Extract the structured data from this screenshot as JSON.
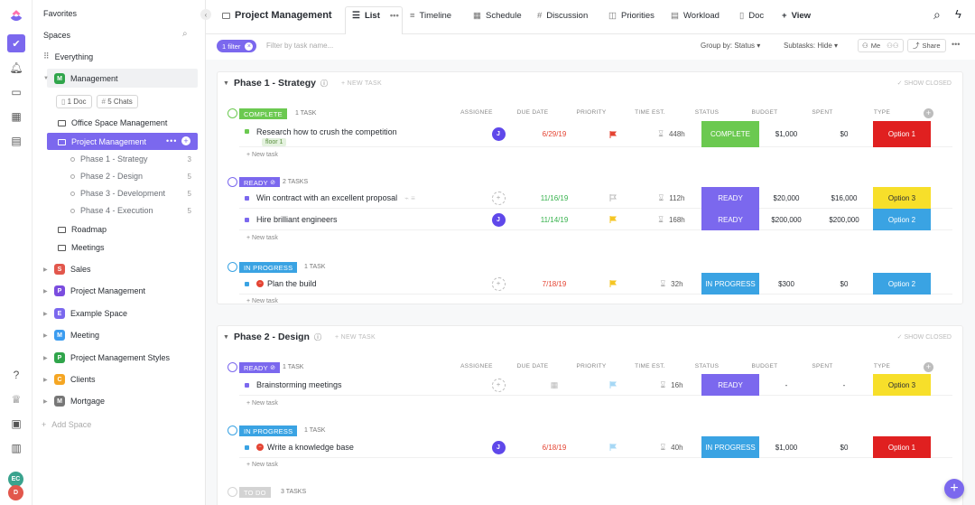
{
  "app": {
    "accent": "#7b68ee"
  },
  "sidebar": {
    "favorites": "Favorites",
    "spaces": "Spaces",
    "everything": "Everything",
    "management": {
      "label": "Management",
      "letter": "M",
      "color": "#30a54b"
    },
    "doc_pill": "1 Doc",
    "chat_pill": "5 Chats",
    "folders": {
      "office": "Office Space Management",
      "pm": "Project Management",
      "roadmap": "Roadmap",
      "meetings": "Meetings"
    },
    "lists": [
      {
        "label": "Phase 1 - Strategy",
        "count": "3"
      },
      {
        "label": "Phase 2 - Design",
        "count": "5"
      },
      {
        "label": "Phase 3 - Development",
        "count": "5"
      },
      {
        "label": "Phase 4 - Execution",
        "count": "5"
      }
    ],
    "spaces_list": [
      {
        "letter": "S",
        "label": "Sales",
        "color": "#e2574c"
      },
      {
        "letter": "P",
        "label": "Project Management",
        "color": "#7b4ddf"
      },
      {
        "letter": "E",
        "label": "Example Space",
        "color": "#7b68ee"
      },
      {
        "letter": "M",
        "label": "Meeting",
        "color": "#3b9cf0"
      },
      {
        "letter": "P",
        "label": "Project Management Styles",
        "color": "#30a54b"
      },
      {
        "letter": "C",
        "label": "Clients",
        "color": "#f5a623"
      },
      {
        "letter": "M",
        "label": "Mortgage",
        "color": "#777777"
      }
    ],
    "add_space": "Add Space"
  },
  "rail": {
    "avatar1": "EC",
    "avatar2": "D"
  },
  "topbar": {
    "title": "Project Management",
    "tabs": [
      "List",
      "Timeline",
      "Schedule",
      "Discussion",
      "Priorities",
      "Workload",
      "Doc"
    ],
    "add_view": "View"
  },
  "filterbar": {
    "filter_chip": "1 filter",
    "search_placeholder": "Filter by task name...",
    "group_by": "Group by: Status",
    "subtasks": "Subtasks: Hide",
    "me": "Me",
    "share": "Share"
  },
  "columns": [
    "ASSIGNEE",
    "DUE DATE",
    "PRIORITY",
    "TIME EST.",
    "STATUS",
    "BUDGET",
    "SPENT",
    "TYPE"
  ],
  "new_task": "+ New task",
  "phases": [
    {
      "title": "Phase 1 - Strategy",
      "new_task_btn": "+ NEW TASK",
      "show_closed": "SHOW CLOSED",
      "groups": [
        {
          "status": "COMPLETE",
          "color": "#6bc950",
          "count": "1 TASK",
          "tasks": [
            {
              "name": "Research how to crush the competition",
              "tag": "floor 1",
              "assignee": "J",
              "due": "6/29/19",
              "due_color": "red",
              "priority_color": "#e44332",
              "time": "448h",
              "status": "COMPLETE",
              "status_color": "#6bc950",
              "budget": "$1,000",
              "spent": "$0",
              "type": "Option 1",
              "type_color": "#e02020",
              "type_text": "#ffffff"
            }
          ]
        },
        {
          "status": "READY",
          "color": "#7b68ee",
          "count": "2 TASKS",
          "tasks": [
            {
              "name": "Win contract with an excellent proposal",
              "assignee": "",
              "due": "11/16/19",
              "due_color": "green",
              "priority_color": "#d0d0d0",
              "time": "112h",
              "status": "READY",
              "status_color": "#7b68ee",
              "budget": "$20,000",
              "spent": "$16,000",
              "type": "Option 3",
              "type_color": "#f7df2a",
              "type_text": "#2a2e34"
            },
            {
              "name": "Hire brilliant engineers",
              "assignee": "J",
              "due": "11/14/19",
              "due_color": "green",
              "priority_color": "#f5c623",
              "time": "168h",
              "status": "READY",
              "status_color": "#7b68ee",
              "budget": "$200,000",
              "spent": "$200,000",
              "type": "Option 2",
              "type_color": "#3aa3e3",
              "type_text": "#ffffff"
            }
          ]
        },
        {
          "status": "IN PROGRESS",
          "color": "#3aa3e3",
          "count": "1 TASK",
          "tasks": [
            {
              "name": "Plan the build",
              "assignee": "",
              "due": "7/18/19",
              "due_color": "red",
              "priority_color": "#f5c623",
              "time": "32h",
              "status": "IN PROGRESS",
              "status_color": "#3aa3e3",
              "budget": "$300",
              "spent": "$0",
              "type": "Option 2",
              "type_color": "#3aa3e3",
              "type_text": "#ffffff"
            }
          ]
        }
      ]
    },
    {
      "title": "Phase 2 - Design",
      "new_task_btn": "+ NEW TASK",
      "show_closed": "SHOW CLOSED",
      "groups": [
        {
          "status": "READY",
          "color": "#7b68ee",
          "count": "1 TASK",
          "tasks": [
            {
              "name": "Brainstorming meetings",
              "assignee": "",
              "due": "",
              "due_color": "",
              "priority_color": "#a7d8f5",
              "time": "16h",
              "status": "READY",
              "status_color": "#7b68ee",
              "budget": "-",
              "spent": "-",
              "type": "Option 3",
              "type_color": "#f7df2a",
              "type_text": "#2a2e34"
            }
          ]
        },
        {
          "status": "IN PROGRESS",
          "color": "#3aa3e3",
          "count": "1 TASK",
          "tasks": [
            {
              "name": "Write a knowledge base",
              "assignee": "J",
              "due": "6/18/19",
              "due_color": "red",
              "priority_color": "#a7d8f5",
              "time": "40h",
              "status": "IN PROGRESS",
              "status_color": "#3aa3e3",
              "budget": "$1,000",
              "spent": "$0",
              "type": "Option 1",
              "type_color": "#e02020",
              "type_text": "#ffffff"
            }
          ]
        },
        {
          "status": "TO DO",
          "color": "#d3d3d3",
          "count": "3 TASKS",
          "tasks": []
        }
      ]
    }
  ]
}
